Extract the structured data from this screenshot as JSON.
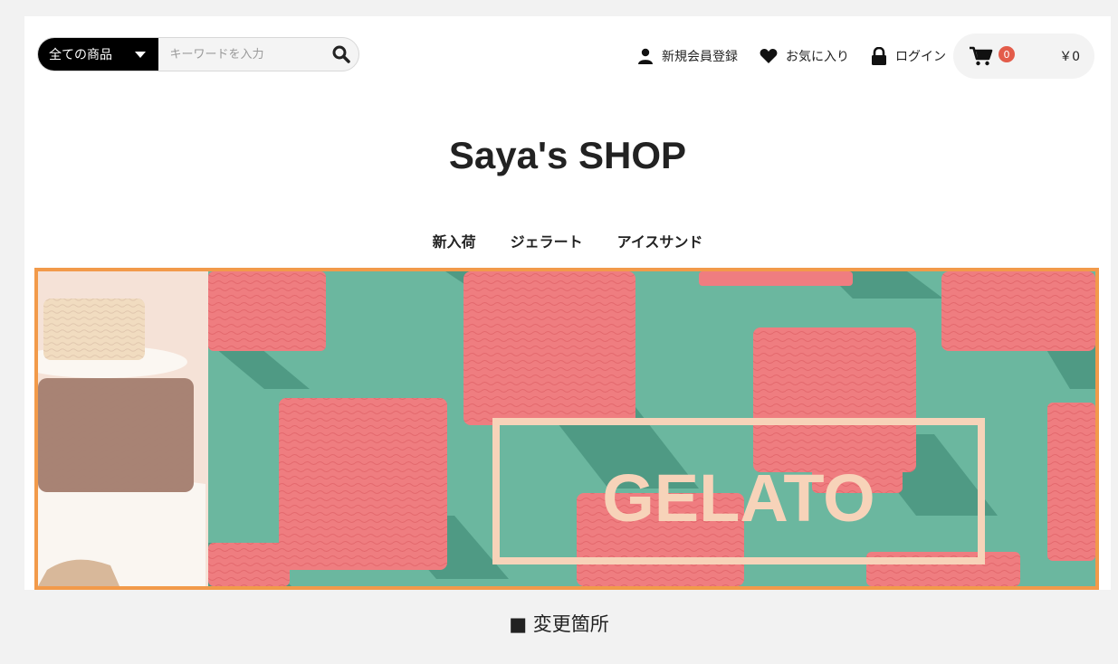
{
  "search": {
    "category": "全ての商品",
    "placeholder": "キーワードを入力"
  },
  "nav": {
    "register": "新規会員登録",
    "favorites": "お気に入り",
    "login": "ログイン",
    "cart_count": "0",
    "cart_total": "￥0"
  },
  "shop": {
    "title": "Saya's SHOP"
  },
  "categories": [
    "新入荷",
    "ジェラート",
    "アイスサンド"
  ],
  "banner": {
    "text": "GELATO"
  },
  "caption": "■ 変更箇所",
  "colors": {
    "highlight_border": "#f29a4a",
    "banner_bg": "#6bb79f",
    "gelato_pink": "#ef7d80",
    "badge": "#e35c4a"
  }
}
